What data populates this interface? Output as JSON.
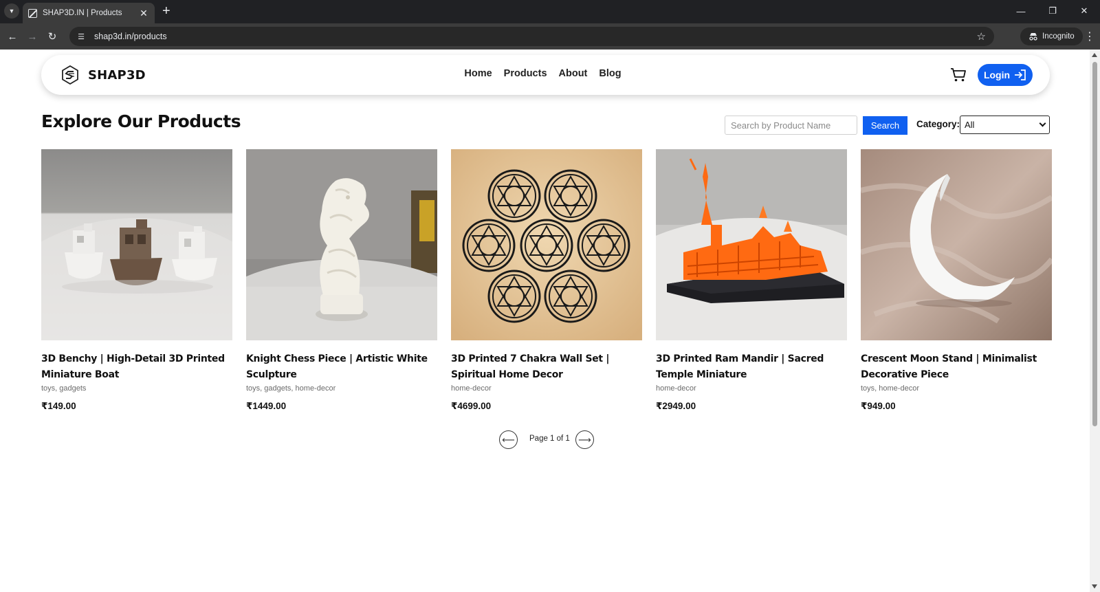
{
  "browser": {
    "tab_title": "SHAP3D.IN | Products",
    "url": "shap3d.in/products",
    "incognito_label": "Incognito"
  },
  "navbar": {
    "brand": "SHAP3D",
    "links": [
      "Home",
      "Products",
      "About",
      "Blog"
    ],
    "login_label": "Login"
  },
  "page": {
    "title": "Explore Our Products",
    "search_placeholder": "Search by Product Name",
    "search_label": "Search",
    "category_label": "Category:",
    "category_selected": "All"
  },
  "products": [
    {
      "title": "3D Benchy | High-Detail 3D Printed Miniature Boat",
      "tags": "toys, gadgets",
      "price": "₹149.00"
    },
    {
      "title": "Knight Chess Piece | Artistic White Sculpture",
      "tags": "toys, gadgets, home-decor",
      "price": "₹1449.00"
    },
    {
      "title": "3D Printed 7 Chakra Wall Set | Spiritual Home Decor",
      "tags": "home-decor",
      "price": "₹4699.00"
    },
    {
      "title": "3D Printed Ram Mandir | Sacred Temple Miniature",
      "tags": "home-decor",
      "price": "₹2949.00"
    },
    {
      "title": "Crescent Moon Stand | Minimalist Decorative Piece",
      "tags": "toys, home-decor",
      "price": "₹949.00"
    }
  ],
  "pagination": {
    "text": "Page 1 of 1"
  },
  "icons": {
    "tab_favicon": "shap3d-favicon-icon",
    "back": "arrow-left-icon",
    "forward": "arrow-right-icon",
    "reload": "reload-icon",
    "site_info": "tune-icon",
    "bookmark": "star-icon",
    "incognito": "incognito-icon",
    "cart": "cart-icon",
    "login": "login-arrow-icon"
  },
  "colors": {
    "accent": "#1060f0",
    "chrome_dark": "#202124",
    "chrome_toolbar": "#3c3c3c"
  }
}
